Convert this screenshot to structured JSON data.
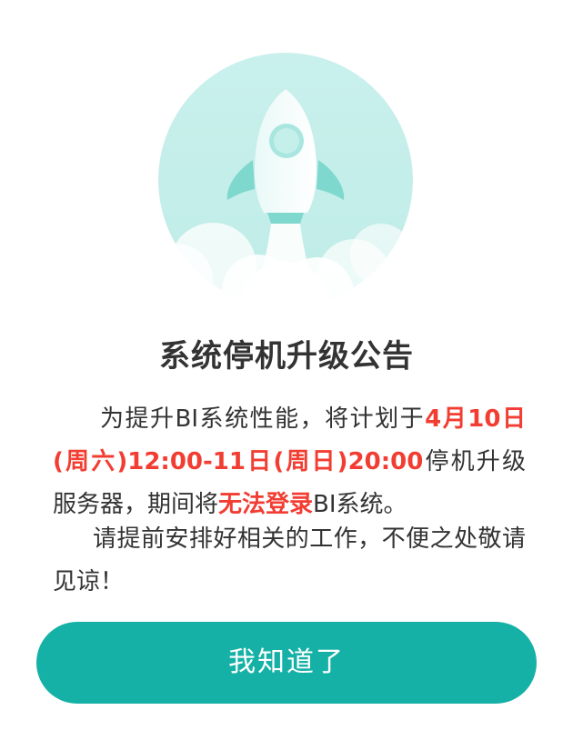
{
  "dialog": {
    "title": "系统停机升级公告",
    "paragraph1": {
      "part1": "为提升BI系统性能，将计划于",
      "highlight_time": "4月10日(周六)12:00-11日(周日)20:00",
      "part2": "停机升级服务器，期间将",
      "highlight_status": "无法登录",
      "part3": "BI系统。"
    },
    "paragraph2": "请提前安排好相关的工作，不便之处敬请见谅！",
    "confirm_button": "我知道了",
    "illustration_icon": "rocket-icon",
    "colors": {
      "accent": "#16b1a6",
      "highlight": "#f23d32",
      "illustration_bg": "#c6efeb",
      "text": "#333333"
    }
  }
}
